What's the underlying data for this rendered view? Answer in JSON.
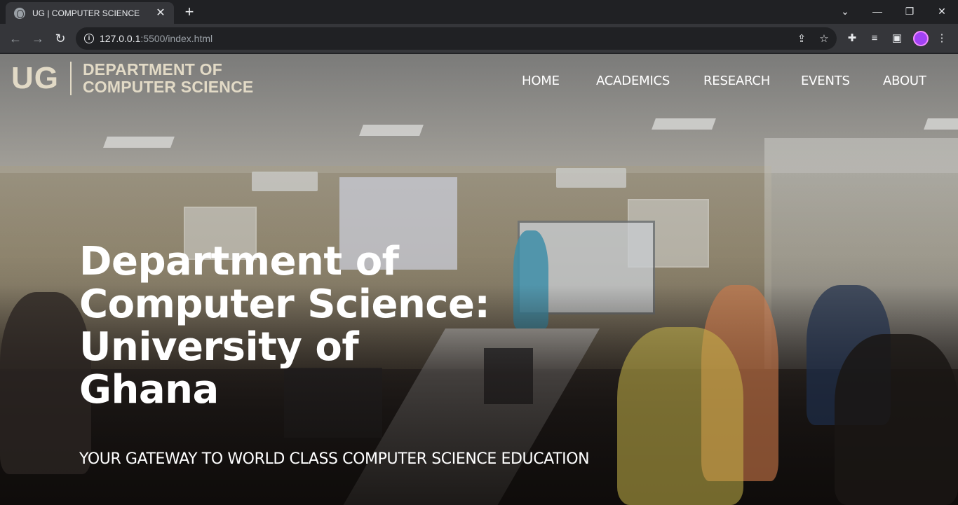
{
  "browser": {
    "tab_title": "UG | COMPUTER SCIENCE",
    "tab_close": "✕",
    "new_tab": "+",
    "url_host": "127.0.0.1",
    "url_path": ":5500/index.html",
    "icons": [
      "back-icon",
      "forward-icon",
      "reload-icon",
      "info-icon",
      "share-icon",
      "star-icon",
      "extensions-icon",
      "media-icon",
      "sidepanel-icon",
      "menu-icon"
    ]
  },
  "site": {
    "logo_ug": "UG",
    "logo_line1": "DEPARTMENT OF",
    "logo_line2": "COMPUTER SCIENCE",
    "nav": [
      "HOME",
      "ACADEMICS",
      "RESEARCH",
      "EVENTS",
      "ABOUT"
    ],
    "hero_title_lines": [
      "Department of",
      "Computer Science:",
      "University of",
      "Ghana"
    ],
    "hero_subtitle": "YOUR GATEWAY TO WORLD CLASS COMPUTER SCIENCE EDUCATION"
  },
  "colors": {
    "logo": "#e2dac6",
    "nav_text": "#ffffff",
    "chrome_dark": "#202124",
    "chrome_mid": "#35363a"
  }
}
